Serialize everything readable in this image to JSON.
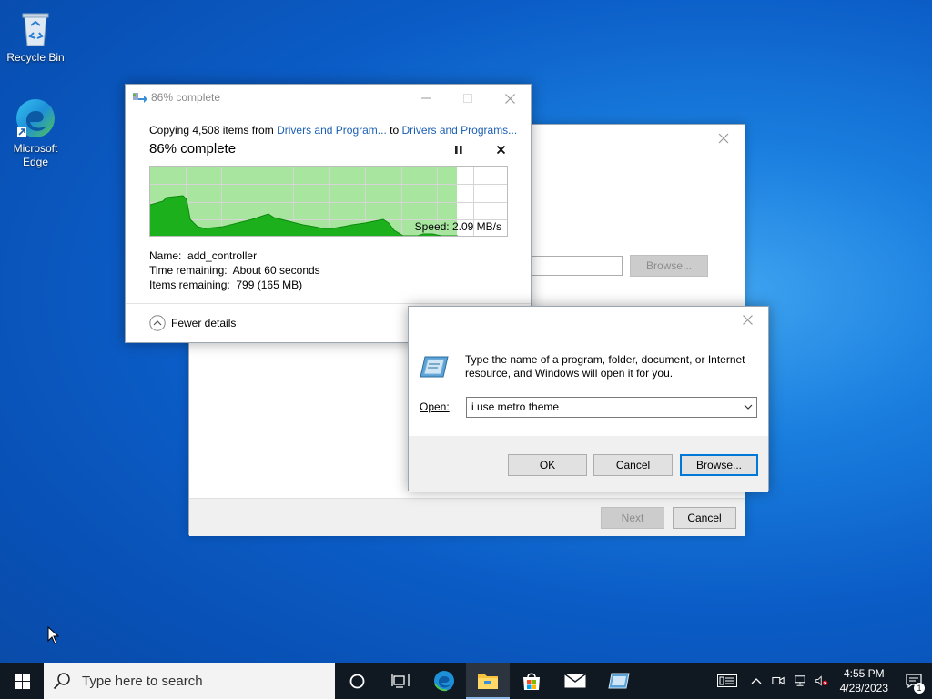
{
  "desktop": {
    "icons": [
      {
        "label": "Recycle Bin"
      },
      {
        "label": "Microsoft Edge"
      }
    ]
  },
  "copy_dialog": {
    "title": "86% complete",
    "copying_prefix": "Copying 4,508 items from",
    "from": "Drivers and Program...",
    "to_word": "to",
    "to": "Drivers and Programs...",
    "heading": "86% complete",
    "progress_fraction": 0.86,
    "speed": "Speed: 2.09 MB/s",
    "name_label": "Name:",
    "name_value": "add_controller",
    "time_label": "Time remaining:",
    "time_value": "About 60 seconds",
    "items_label": "Items remaining:",
    "items_value": "799 (165 MB)",
    "fewer_details": "Fewer details",
    "graph_color": "#4cd44c",
    "graph_fill_color": "#a8e6a0"
  },
  "wizard": {
    "browse_label": "Browse...",
    "next_label": "Next",
    "cancel_label": "Cancel"
  },
  "run_dialog": {
    "description": "Type the name of a program, folder, document, or Internet resource, and Windows will open it for you.",
    "open_label": "Open:",
    "open_value": "i use metro theme",
    "ok_label": "OK",
    "cancel_label": "Cancel",
    "browse_label": "Browse..."
  },
  "taskbar": {
    "search_placeholder": "Type here to search",
    "time": "4:55 PM",
    "date": "4/28/2023",
    "notification_count": "1",
    "accent_color": "#0078d7"
  }
}
